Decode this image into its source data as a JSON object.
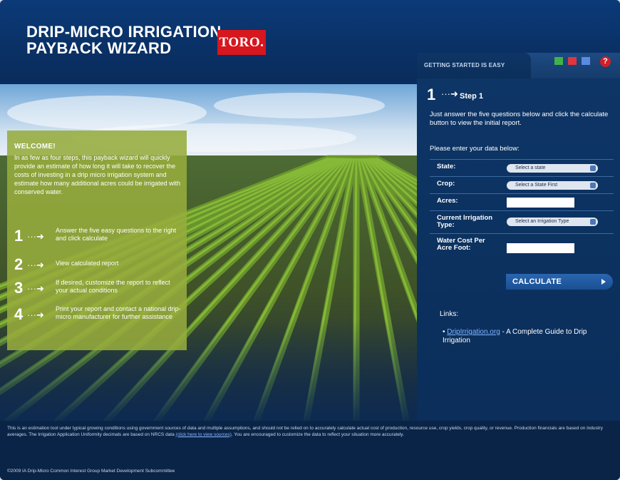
{
  "header": {
    "title_line1": "DRIP-MICRO IRRIGATION",
    "title_line2": "PAYBACK WIZARD",
    "brand": "TORO."
  },
  "getting_started": {
    "label": "GETTING STARTED IS EASY",
    "squares": [
      {
        "name": "green-square-icon",
        "color": "#3fb34a"
      },
      {
        "name": "red-square-icon",
        "color": "#e0353f"
      },
      {
        "name": "blue-square-icon",
        "color": "#5b8be0"
      }
    ],
    "help_icon": "?"
  },
  "welcome": {
    "title": "WELCOME!",
    "text": "In as few as four steps, this payback wizard will quickly provide an estimate of how long it will take to recover the costs of investing in a drip micro irrigation system and estimate how many additional acres could be irrigated with conserved water.",
    "steps": [
      {
        "num": "1",
        "text": "Answer the five easy questions to the right and click calculate"
      },
      {
        "num": "2",
        "text": "View calculated report"
      },
      {
        "num": "3",
        "text": "If desired, customize the report to reflect your actual conditions"
      },
      {
        "num": "4",
        "text": "Print your report and contact a national drip-micro manufacturer for further assistance"
      }
    ]
  },
  "step_panel": {
    "step_num": "1",
    "step_label": "Step 1",
    "instructions": "Just answer the five questions below and click the calculate button to view the initial report.",
    "enter_label": "Please enter your data below:",
    "fields": {
      "state": {
        "label": "State:",
        "value": "Select a state"
      },
      "crop": {
        "label": "Crop:",
        "value": "Select a State First"
      },
      "acres": {
        "label": "Acres:",
        "value": ""
      },
      "irrigation": {
        "label": "Current Irrigation Type:",
        "value": "Select an Irrigation Type"
      },
      "water_cost": {
        "label": "Water Cost Per Acre Foot:",
        "value": ""
      }
    },
    "calculate_label": "CALCULATE",
    "links_heading": "Links:",
    "link_text": "DripIrrigation.org",
    "link_suffix": " - A Complete Guide to Drip Irrigation"
  },
  "footer": {
    "text": "This is an estimation tool under typical growing conditions using government sources of data and multiple assumptions, and should not be relied on to accurately calculate actual cost of production, resource use, crop yields, crop quality, or revenue. Production financials are based on industry averages. The Irrigation Application Uniformity decimals are based on NRCS data ",
    "link_text": "(click here to view sources)",
    "text_after": ". You are encouraged to customize the data to reflect your situation more accurately.",
    "copyright": "©2009 IA Drip-Micro Common Interest Group Market Development Subcommittee"
  }
}
